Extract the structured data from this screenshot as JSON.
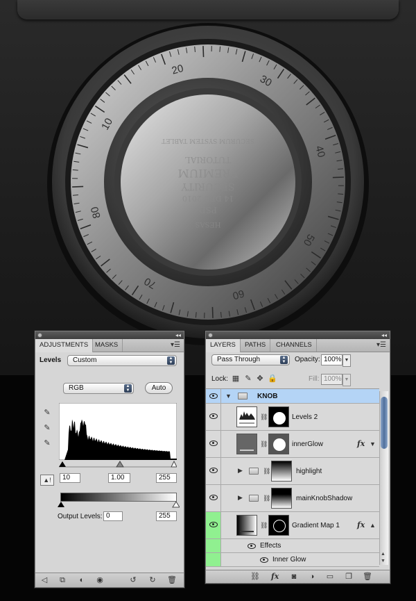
{
  "canvas": {
    "dial_numbers": [
      "10",
      "20",
      "30",
      "40",
      "50",
      "60",
      "70",
      "80"
    ],
    "engraving_lines": [
      "HESAS",
      "PSD",
      "14 DEC 2010",
      "SECURITY",
      "PREMIUM",
      "TUTORIAL",
      "SECURUM SYSTEM TABLET"
    ]
  },
  "adjustments": {
    "tabs": [
      "ADJUSTMENTS",
      "MASKS"
    ],
    "levels_label": "Levels",
    "preset": "Custom",
    "channel": "RGB",
    "auto_label": "Auto",
    "input_black": "10",
    "input_gamma": "1.00",
    "input_white": "255",
    "output_label": "Output Levels:",
    "output_black": "0",
    "output_white": "255",
    "footer_icons": [
      "back-arrow-icon",
      "clip-icon",
      "mask-icon",
      "visibility-icon",
      "reset-previous-icon",
      "reset-icon",
      "trash-icon"
    ]
  },
  "layers": {
    "tabs": [
      "LAYERS",
      "PATHS",
      "CHANNELS"
    ],
    "blend_mode": "Pass Through",
    "opacity_label": "Opacity:",
    "opacity_value": "100%",
    "lock_label": "Lock:",
    "fill_label": "Fill:",
    "fill_value": "100%",
    "rows": [
      {
        "name": "KNOB",
        "kind": "group-open"
      },
      {
        "name": "Levels 2",
        "kind": "adjustment"
      },
      {
        "name": "innerGlow",
        "kind": "layer",
        "fx": "fx"
      },
      {
        "name": "highlight",
        "kind": "group"
      },
      {
        "name": "mainKnobShadow",
        "kind": "group"
      },
      {
        "name": "Gradient Map 1",
        "kind": "adjustment",
        "fx": "fx"
      },
      {
        "name": "Effects",
        "kind": "effects"
      },
      {
        "name": "Inner Glow",
        "kind": "effect"
      }
    ],
    "footer_icons": [
      "link-icon",
      "fx-icon",
      "mask-icon",
      "adjustment-icon",
      "folder-icon",
      "new-layer-icon",
      "trash-icon"
    ],
    "selected_color": "#b4d4f6",
    "visibility_highlight": "#90f090"
  }
}
